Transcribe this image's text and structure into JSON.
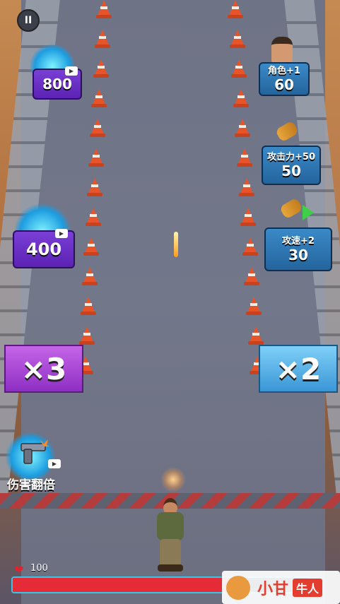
{
  "hud": {
    "health_value": "100",
    "health_fraction": 0.75
  },
  "left_powerups": [
    {
      "value": "800"
    },
    {
      "value": "400"
    }
  ],
  "right_powerups": [
    {
      "label": "角色+1",
      "value": "60"
    },
    {
      "label": "攻击力+50",
      "value": "50"
    },
    {
      "label": "攻速+2",
      "value": "30"
    }
  ],
  "gates": {
    "left": "×3",
    "right": "×2"
  },
  "double_damage": {
    "label": "伤害翻倍"
  },
  "watermark": {
    "brand": "小甘",
    "tag": "牛人"
  }
}
